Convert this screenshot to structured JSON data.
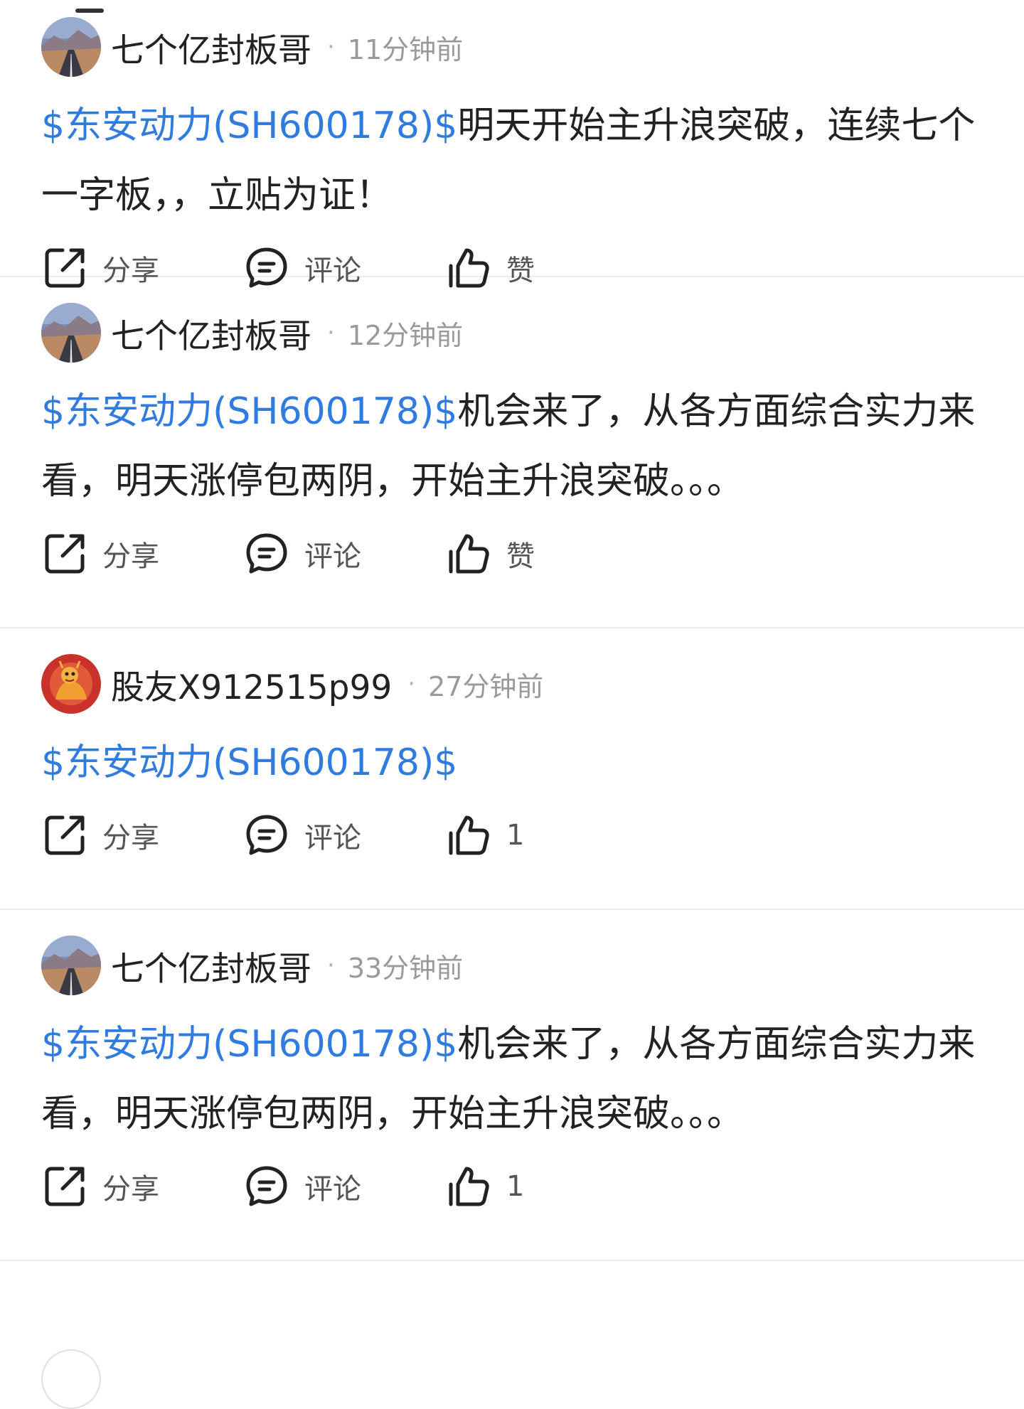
{
  "posts": [
    {
      "author": "七个亿封板哥",
      "avatar_icon": "desert-road-avatar-icon",
      "time": "11分钟前",
      "stock": "$东安动力(SH600178)$",
      "text": "明天开始主升浪突破，连续七个一字板，，立贴为证！",
      "share_label": "分享",
      "comment_label": "评论",
      "like_label": "赞"
    },
    {
      "author": "七个亿封板哥",
      "avatar_icon": "desert-road-avatar-icon",
      "time": "12分钟前",
      "stock": "$东安动力(SH600178)$",
      "text": "机会来了，从各方面综合实力来看，明天涨停包两阴，开始主升浪突破。。。",
      "share_label": "分享",
      "comment_label": "评论",
      "like_label": "赞"
    },
    {
      "author": "股友X912515p99",
      "avatar_icon": "dragon-avatar-icon",
      "time": "27分钟前",
      "stock": "$东安动力(SH600178)$",
      "text": "",
      "share_label": "分享",
      "comment_label": "评论",
      "like_label": "1"
    },
    {
      "author": "七个亿封板哥",
      "avatar_icon": "desert-road-avatar-icon",
      "time": "33分钟前",
      "stock": "$东安动力(SH600178)$",
      "text": "机会来了，从各方面综合实力来看，明天涨停包两阴，开始主升浪突破。。。",
      "share_label": "分享",
      "comment_label": "评论",
      "like_label": "1"
    }
  ],
  "colors": {
    "stock_link": "#2f7be0",
    "text": "#222222",
    "secondary_text": "#9a9a9a",
    "divider": "#ececec"
  },
  "icons": {
    "share": "share-icon",
    "comment": "comment-icon",
    "like": "thumbs-up-icon"
  }
}
